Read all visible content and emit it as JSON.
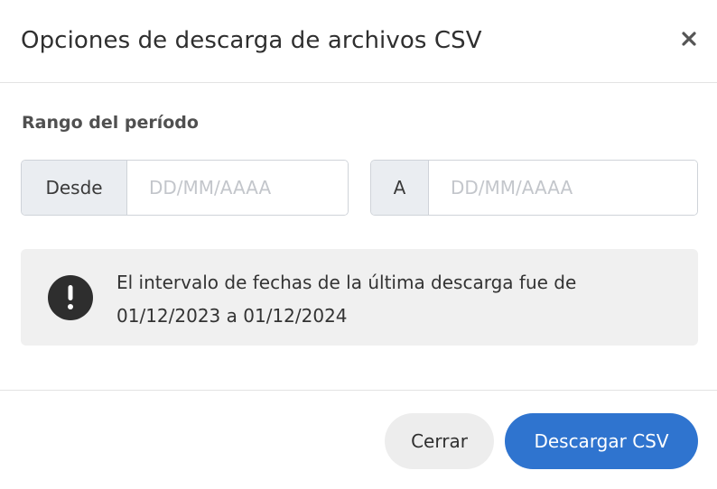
{
  "dialog": {
    "title": "Opciones de descarga de archivos CSV",
    "close_icon": "close-icon"
  },
  "range": {
    "label": "Rango del período",
    "from": {
      "label": "Desde",
      "value": "",
      "placeholder": "DD/MM/AAAA"
    },
    "to": {
      "label": "A",
      "value": "",
      "placeholder": "DD/MM/AAAA"
    }
  },
  "notice": {
    "icon": "alert-icon",
    "text": "El intervalo de fechas de la última descarga fue de 01/12/2023 a 01/12/2024"
  },
  "footer": {
    "close_label": "Cerrar",
    "download_label": "Descargar CSV"
  },
  "colors": {
    "primary": "#2f74cf",
    "secondary_button": "#ededed",
    "notice_background": "#f0f0f0",
    "addon_background": "#eaedf1"
  }
}
